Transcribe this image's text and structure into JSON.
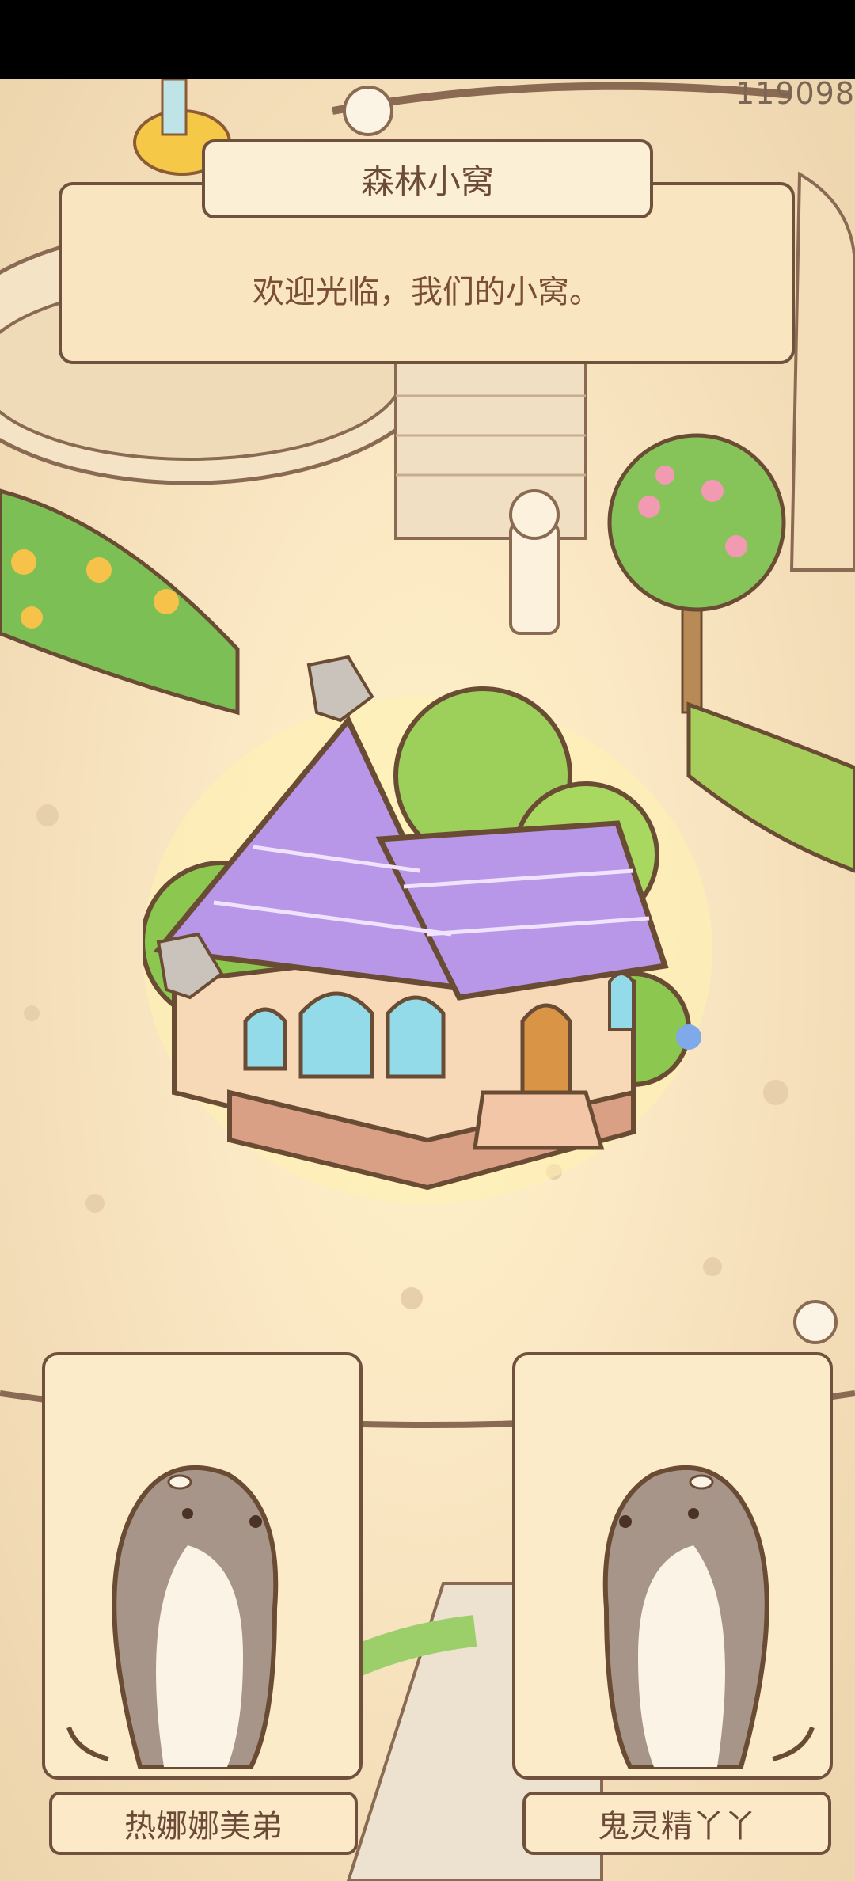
{
  "status_bar": {},
  "score": "119098",
  "dialog": {
    "title": "森林小窝",
    "message": "欢迎光临，我们的小窝。"
  },
  "characters": [
    {
      "name": "热娜娜美弟",
      "avatar_icon": "otter-icon"
    },
    {
      "name": "鬼灵精丫丫",
      "avatar_icon": "otter-icon"
    }
  ],
  "building": {
    "icon": "purple-roof-cottage-icon"
  },
  "colors": {
    "border": "#6f513d",
    "panel": "#f9e5c0",
    "roof": "#b997e8",
    "text": "#6b4a37"
  }
}
